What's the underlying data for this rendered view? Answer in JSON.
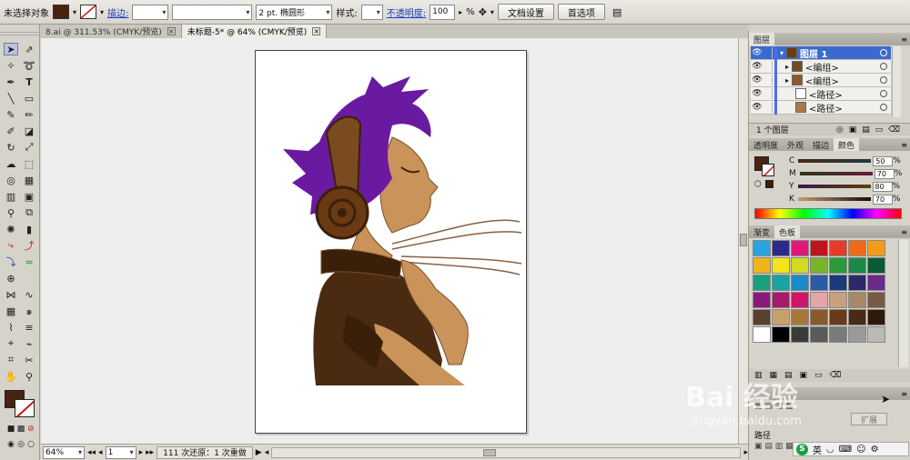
{
  "control_bar": {
    "no_selection": "未选择对象",
    "fill_color": "#4a2210",
    "stroke_label": "描边:",
    "stroke_weight": "",
    "brush_value": "2 pt. 椭圆形",
    "style_label": "样式:",
    "opacity_label": "不透明度:",
    "opacity_value": "100",
    "opacity_unit": "%",
    "doc_setup": "文档设置",
    "preferences": "首选项"
  },
  "tabs": [
    {
      "label": "8.ai @ 311.53% (CMYK/预览)",
      "close": "×"
    },
    {
      "label": "未标题-5* @ 64% (CMYK/预览)",
      "close": "×"
    }
  ],
  "status": {
    "zoom": "64%",
    "page": "1",
    "undo_text": "111 次还原：1 次重做"
  },
  "layers_panel": {
    "title": "图层",
    "rows": [
      {
        "label": "图层 1",
        "selected": true
      },
      {
        "label": "<编组>"
      },
      {
        "label": "<编组>"
      },
      {
        "label": "<路径>"
      },
      {
        "label": "<路径>"
      }
    ],
    "count": "1 个图层"
  },
  "color_panel": {
    "tabs": [
      "透明度",
      "外观",
      "描边",
      "颜色"
    ],
    "channels": [
      {
        "name": "C",
        "value": "50",
        "unit": "%"
      },
      {
        "name": "M",
        "value": "70",
        "unit": "%"
      },
      {
        "name": "Y",
        "value": "80",
        "unit": "%"
      },
      {
        "name": "K",
        "value": "70",
        "unit": "%"
      }
    ]
  },
  "swatches_panel": {
    "tabs": [
      "渐变",
      "色板"
    ],
    "colors": [
      "#2aa4e0",
      "#2a2a8a",
      "#e0187a",
      "#c0141c",
      "#e83a28",
      "#f06a1a",
      "#f49c1a",
      "#f0b41a",
      "#f4e41a",
      "#d0dc20",
      "#78b42a",
      "#2a9a3a",
      "#1a8a4a",
      "#0a5a34",
      "#1aa07a",
      "#16a4a4",
      "#1a8ac8",
      "#2a5aa8",
      "#1a3a7a",
      "#2a2a6a",
      "#6a2a8a",
      "#8a1a7a",
      "#a81a6a",
      "#d0146a",
      "#e4a4a8",
      "#c8a080",
      "#a88868",
      "#7a5a44",
      "#5a4030",
      "#c8a06a",
      "#a8783a",
      "#8a5a2a",
      "#6a3a1a",
      "#4a2a14",
      "#2e1a0c",
      "#ffffff",
      "#000000",
      "#3a3a3a",
      "#5a5a5a",
      "#7a7a7a",
      "#9a9a9a",
      "#bababa"
    ]
  },
  "bottom_panel": {
    "label1": "路径",
    "label2": "扩展"
  },
  "watermark": {
    "brand": "Bai 经验",
    "url": "jingyan.baidu.com"
  },
  "ime": {
    "lang": "英"
  }
}
